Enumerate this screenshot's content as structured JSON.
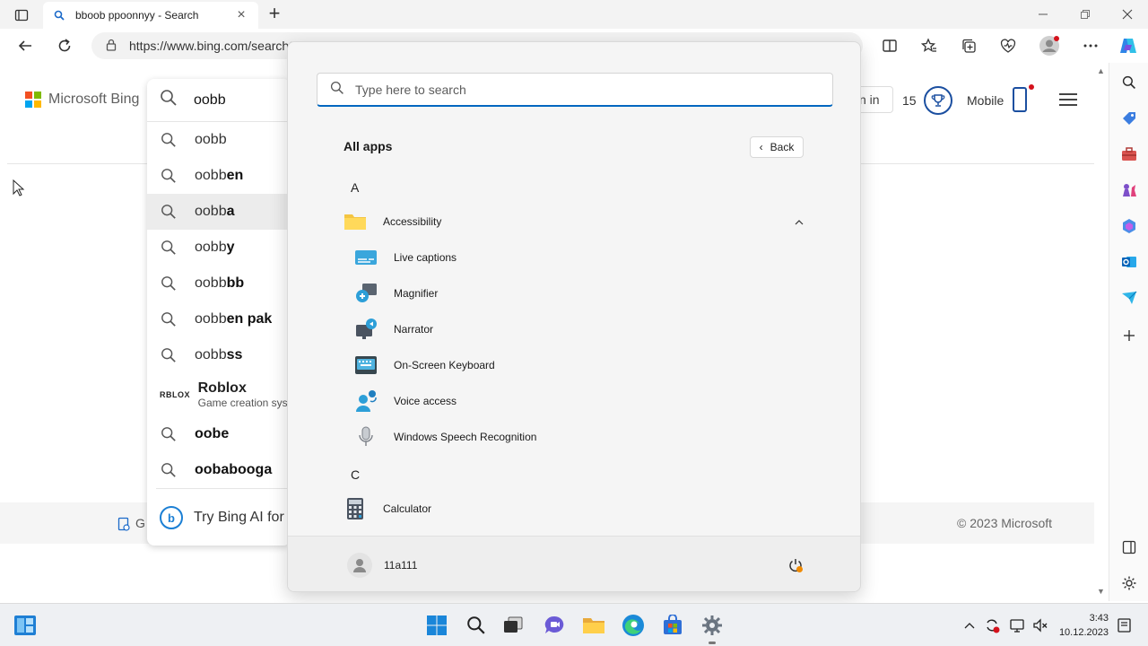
{
  "browser": {
    "tab_title": "bboob ppoonnyy - Search",
    "new_tab_symbol": "+",
    "address": "https://www.bing.com/search?q=oobb"
  },
  "bing": {
    "logo_text": "Microsoft Bing",
    "signin_label": "n in",
    "points": "15",
    "mobile_label": "Mobile",
    "footer_copyright": "© 2023 Microsoft",
    "footer_partial": "G"
  },
  "suggestions": {
    "query": "oobb",
    "items": [
      {
        "prefix": "oobb",
        "suffix": ""
      },
      {
        "prefix": "oobb",
        "suffix": "en"
      },
      {
        "prefix": "oobb",
        "suffix": "a"
      },
      {
        "prefix": "oobb",
        "suffix": "y"
      },
      {
        "prefix": "oobb",
        "suffix": "bb"
      },
      {
        "prefix": "oobb",
        "suffix": "en pak"
      },
      {
        "prefix": "oobb",
        "suffix": "ss"
      }
    ],
    "roblox": {
      "logo": "RBLOX",
      "title": "Roblox",
      "subtitle": "Game creation syst"
    },
    "items2": [
      {
        "text": "oobe"
      },
      {
        "text": "oobabooga"
      }
    ],
    "try_bing": "Try Bing AI for"
  },
  "start_menu": {
    "search_placeholder": "Type here to search",
    "all_apps": "All apps",
    "back_label": "Back",
    "letter_a": "A",
    "folder": "Accessibility",
    "apps": [
      "Live captions",
      "Magnifier",
      "Narrator",
      "On-Screen Keyboard",
      "Voice access",
      "Windows Speech Recognition"
    ],
    "letter_c": "C",
    "calculator": "Calculator",
    "user": "11a111"
  },
  "taskbar": {
    "time": "3:43",
    "date": "10.12.2023"
  },
  "colors": {
    "accent": "#0067c0",
    "bing_blue": "#1b4fa0",
    "notification_red": "#d4121c"
  }
}
